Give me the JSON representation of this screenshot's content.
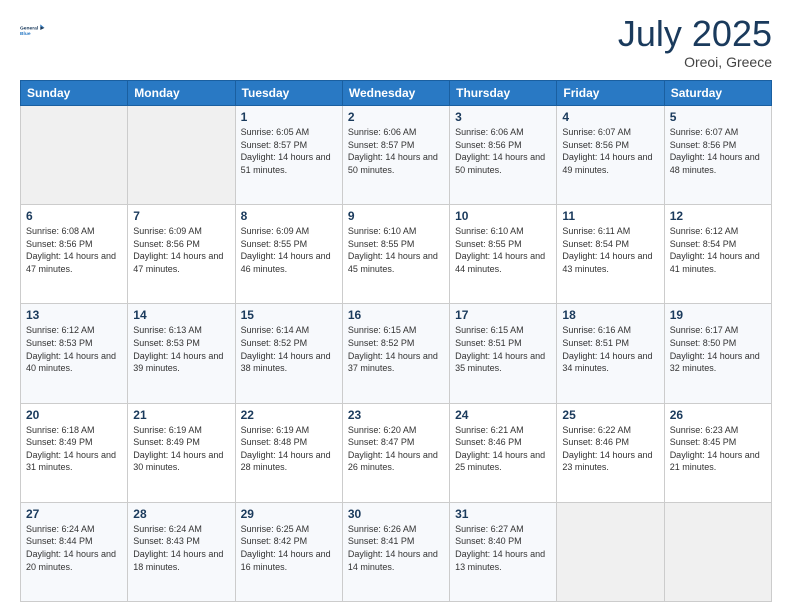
{
  "header": {
    "logo_general": "General",
    "logo_blue": "Blue",
    "month": "July 2025",
    "location": "Oreoi, Greece"
  },
  "days_of_week": [
    "Sunday",
    "Monday",
    "Tuesday",
    "Wednesday",
    "Thursday",
    "Friday",
    "Saturday"
  ],
  "weeks": [
    [
      {
        "day": "",
        "info": ""
      },
      {
        "day": "",
        "info": ""
      },
      {
        "day": "1",
        "info": "Sunrise: 6:05 AM\nSunset: 8:57 PM\nDaylight: 14 hours and 51 minutes."
      },
      {
        "day": "2",
        "info": "Sunrise: 6:06 AM\nSunset: 8:57 PM\nDaylight: 14 hours and 50 minutes."
      },
      {
        "day": "3",
        "info": "Sunrise: 6:06 AM\nSunset: 8:56 PM\nDaylight: 14 hours and 50 minutes."
      },
      {
        "day": "4",
        "info": "Sunrise: 6:07 AM\nSunset: 8:56 PM\nDaylight: 14 hours and 49 minutes."
      },
      {
        "day": "5",
        "info": "Sunrise: 6:07 AM\nSunset: 8:56 PM\nDaylight: 14 hours and 48 minutes."
      }
    ],
    [
      {
        "day": "6",
        "info": "Sunrise: 6:08 AM\nSunset: 8:56 PM\nDaylight: 14 hours and 47 minutes."
      },
      {
        "day": "7",
        "info": "Sunrise: 6:09 AM\nSunset: 8:56 PM\nDaylight: 14 hours and 47 minutes."
      },
      {
        "day": "8",
        "info": "Sunrise: 6:09 AM\nSunset: 8:55 PM\nDaylight: 14 hours and 46 minutes."
      },
      {
        "day": "9",
        "info": "Sunrise: 6:10 AM\nSunset: 8:55 PM\nDaylight: 14 hours and 45 minutes."
      },
      {
        "day": "10",
        "info": "Sunrise: 6:10 AM\nSunset: 8:55 PM\nDaylight: 14 hours and 44 minutes."
      },
      {
        "day": "11",
        "info": "Sunrise: 6:11 AM\nSunset: 8:54 PM\nDaylight: 14 hours and 43 minutes."
      },
      {
        "day": "12",
        "info": "Sunrise: 6:12 AM\nSunset: 8:54 PM\nDaylight: 14 hours and 41 minutes."
      }
    ],
    [
      {
        "day": "13",
        "info": "Sunrise: 6:12 AM\nSunset: 8:53 PM\nDaylight: 14 hours and 40 minutes."
      },
      {
        "day": "14",
        "info": "Sunrise: 6:13 AM\nSunset: 8:53 PM\nDaylight: 14 hours and 39 minutes."
      },
      {
        "day": "15",
        "info": "Sunrise: 6:14 AM\nSunset: 8:52 PM\nDaylight: 14 hours and 38 minutes."
      },
      {
        "day": "16",
        "info": "Sunrise: 6:15 AM\nSunset: 8:52 PM\nDaylight: 14 hours and 37 minutes."
      },
      {
        "day": "17",
        "info": "Sunrise: 6:15 AM\nSunset: 8:51 PM\nDaylight: 14 hours and 35 minutes."
      },
      {
        "day": "18",
        "info": "Sunrise: 6:16 AM\nSunset: 8:51 PM\nDaylight: 14 hours and 34 minutes."
      },
      {
        "day": "19",
        "info": "Sunrise: 6:17 AM\nSunset: 8:50 PM\nDaylight: 14 hours and 32 minutes."
      }
    ],
    [
      {
        "day": "20",
        "info": "Sunrise: 6:18 AM\nSunset: 8:49 PM\nDaylight: 14 hours and 31 minutes."
      },
      {
        "day": "21",
        "info": "Sunrise: 6:19 AM\nSunset: 8:49 PM\nDaylight: 14 hours and 30 minutes."
      },
      {
        "day": "22",
        "info": "Sunrise: 6:19 AM\nSunset: 8:48 PM\nDaylight: 14 hours and 28 minutes."
      },
      {
        "day": "23",
        "info": "Sunrise: 6:20 AM\nSunset: 8:47 PM\nDaylight: 14 hours and 26 minutes."
      },
      {
        "day": "24",
        "info": "Sunrise: 6:21 AM\nSunset: 8:46 PM\nDaylight: 14 hours and 25 minutes."
      },
      {
        "day": "25",
        "info": "Sunrise: 6:22 AM\nSunset: 8:46 PM\nDaylight: 14 hours and 23 minutes."
      },
      {
        "day": "26",
        "info": "Sunrise: 6:23 AM\nSunset: 8:45 PM\nDaylight: 14 hours and 21 minutes."
      }
    ],
    [
      {
        "day": "27",
        "info": "Sunrise: 6:24 AM\nSunset: 8:44 PM\nDaylight: 14 hours and 20 minutes."
      },
      {
        "day": "28",
        "info": "Sunrise: 6:24 AM\nSunset: 8:43 PM\nDaylight: 14 hours and 18 minutes."
      },
      {
        "day": "29",
        "info": "Sunrise: 6:25 AM\nSunset: 8:42 PM\nDaylight: 14 hours and 16 minutes."
      },
      {
        "day": "30",
        "info": "Sunrise: 6:26 AM\nSunset: 8:41 PM\nDaylight: 14 hours and 14 minutes."
      },
      {
        "day": "31",
        "info": "Sunrise: 6:27 AM\nSunset: 8:40 PM\nDaylight: 14 hours and 13 minutes."
      },
      {
        "day": "",
        "info": ""
      },
      {
        "day": "",
        "info": ""
      }
    ]
  ]
}
